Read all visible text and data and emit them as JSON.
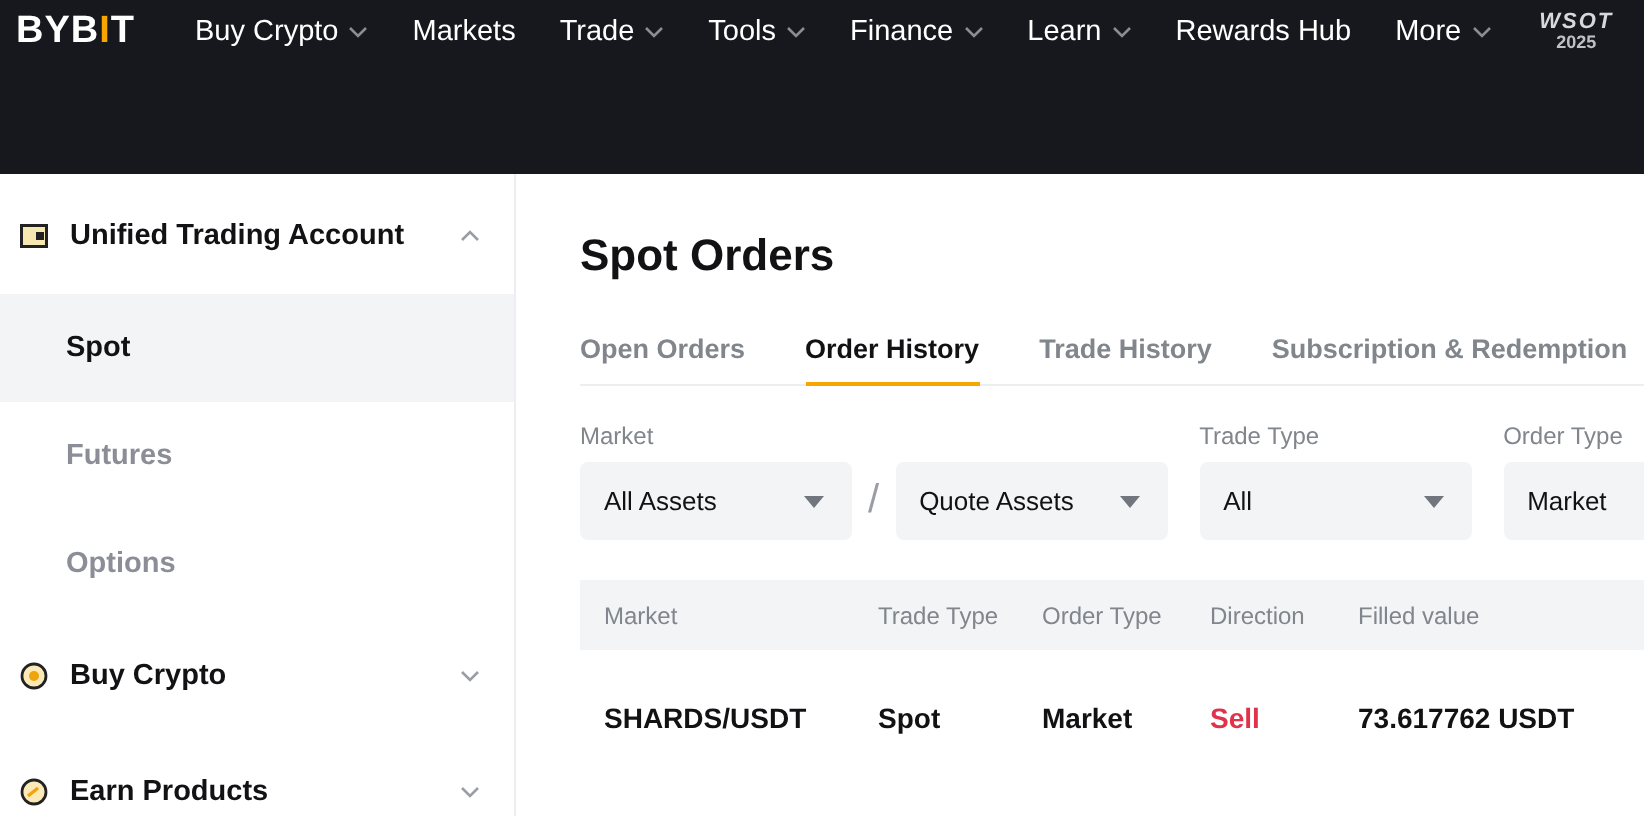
{
  "header": {
    "logo": "BYBIT",
    "nav": [
      {
        "label": "Buy Crypto",
        "dropdown": true
      },
      {
        "label": "Markets",
        "dropdown": false
      },
      {
        "label": "Trade",
        "dropdown": true
      },
      {
        "label": "Tools",
        "dropdown": true
      },
      {
        "label": "Finance",
        "dropdown": true
      },
      {
        "label": "Learn",
        "dropdown": true
      },
      {
        "label": "Rewards Hub",
        "dropdown": false
      },
      {
        "label": "More",
        "dropdown": true
      }
    ],
    "badge": {
      "title": "WSOT",
      "year": "2025"
    }
  },
  "sidebar": {
    "items": [
      {
        "label": "Unified Trading Account",
        "kind": "card",
        "expanded": true,
        "children": [
          {
            "label": "Spot",
            "selected": true
          },
          {
            "label": "Futures",
            "selected": false
          },
          {
            "label": "Options",
            "selected": false
          }
        ]
      },
      {
        "label": "Buy Crypto",
        "kind": "coin",
        "expanded": false
      },
      {
        "label": "Earn Products",
        "kind": "gauge",
        "expanded": false
      }
    ]
  },
  "page": {
    "title": "Spot Orders",
    "tabs": [
      {
        "label": "Open Orders",
        "selected": false
      },
      {
        "label": "Order History",
        "selected": true
      },
      {
        "label": "Trade History",
        "selected": false
      },
      {
        "label": "Subscription & Redemption",
        "selected": false
      }
    ],
    "filters": [
      {
        "label": "Market",
        "value": "All Assets",
        "caret": true
      },
      {
        "separator": "/",
        "value": "Quote Assets",
        "caret": true
      },
      {
        "label": "Trade Type",
        "value": "All",
        "caret": true
      },
      {
        "label": "Order Type",
        "value": "Market"
      }
    ],
    "table": {
      "columns": [
        "Market",
        "Trade Type",
        "Order Type",
        "Direction",
        "Filled value"
      ],
      "rows": [
        {
          "market": "SHARDS/USDT",
          "trade_type": "Spot",
          "order_type": "Market",
          "direction": {
            "text": "Sell",
            "color": "#e0334b"
          },
          "filled_value": "73.617762 USDT"
        }
      ]
    }
  }
}
